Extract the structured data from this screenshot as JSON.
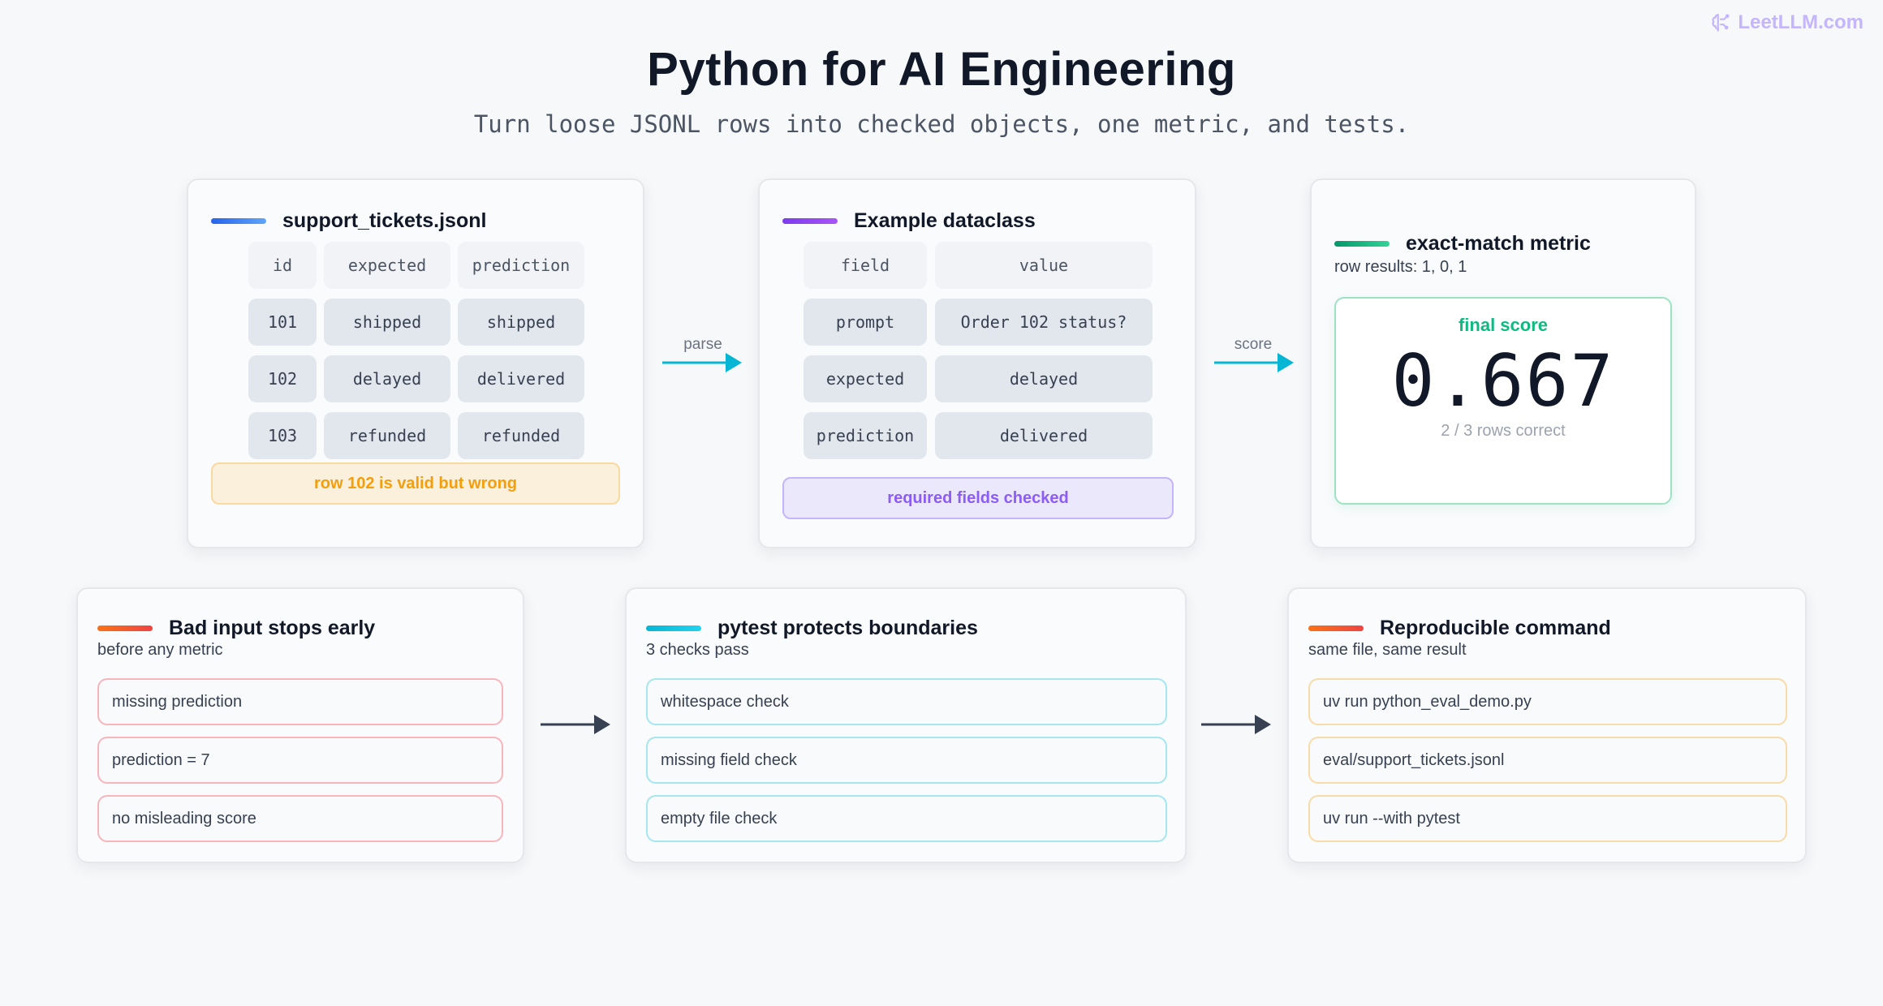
{
  "brand": {
    "name": "LeetLLM.com",
    "icon": "brain-icon"
  },
  "title": "Python for AI Engineering",
  "subtitle": "Turn loose JSONL rows into checked objects, one metric, and tests.",
  "colors": {
    "blue": "#3b82f6",
    "purple": "#8b5cf6",
    "green": "#10b981",
    "orange": "#f97316",
    "cyan": "#06b6d4",
    "arrow_cyan": "#06b6d4",
    "arrow_dark": "#374151"
  },
  "tickets_card": {
    "title": "support_tickets.jsonl",
    "headers": [
      "id",
      "expected",
      "prediction"
    ],
    "rows": [
      [
        "101",
        "shipped",
        "shipped"
      ],
      [
        "102",
        "delayed",
        "delivered"
      ],
      [
        "103",
        "refunded",
        "refunded"
      ]
    ],
    "banner": "row 102 is valid but wrong"
  },
  "arrow_parse": "parse",
  "dataclass_card": {
    "title": "Example dataclass",
    "headers": [
      "field",
      "value"
    ],
    "rows": [
      [
        "prompt",
        "Order 102 status?"
      ],
      [
        "expected",
        "delayed"
      ],
      [
        "prediction",
        "delivered"
      ]
    ],
    "banner": "required fields checked"
  },
  "arrow_score": "score",
  "metric_card": {
    "title": "exact-match metric",
    "subtitle": "row results: 1, 0, 1",
    "score_label": "final score",
    "score_value": "0.667",
    "score_note": "2 / 3 rows correct"
  },
  "bad_input_card": {
    "title": "Bad input stops early",
    "subtitle": "before any metric",
    "items": [
      "missing prediction",
      "prediction = 7",
      "no misleading score"
    ]
  },
  "pytest_card": {
    "title": "pytest protects boundaries",
    "subtitle": "3 checks pass",
    "items": [
      "whitespace check",
      "missing field check",
      "empty file check"
    ]
  },
  "command_card": {
    "title": "Reproducible command",
    "subtitle": "same file, same result",
    "items": [
      "uv run python_eval_demo.py",
      "eval/support_tickets.jsonl",
      "uv run --with pytest"
    ]
  }
}
